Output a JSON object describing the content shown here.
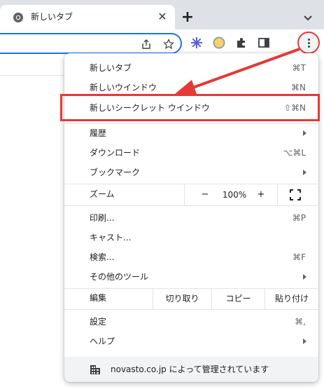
{
  "tab": {
    "title": "新しいタブ",
    "close": "✕"
  },
  "newtab": "+",
  "colors": {
    "annotation": "#e53935",
    "accent": "#1a73e8"
  },
  "menu": {
    "new_tab": {
      "label": "新しいタブ",
      "shortcut": "⌘T"
    },
    "new_window": {
      "label": "新しいウインドウ",
      "shortcut": "⌘N"
    },
    "incognito": {
      "label": "新しいシークレット ウインドウ",
      "shortcut": "⇧⌘N"
    },
    "history": {
      "label": "履歴"
    },
    "downloads": {
      "label": "ダウンロード",
      "shortcut": "⌥⌘L"
    },
    "bookmarks": {
      "label": "ブックマーク"
    },
    "zoom": {
      "label": "ズーム",
      "minus": "−",
      "value": "100%",
      "plus": "+"
    },
    "print": {
      "label": "印刷...",
      "shortcut": "⌘P"
    },
    "cast": {
      "label": "キャスト..."
    },
    "find": {
      "label": "検索...",
      "shortcut": "⌘F"
    },
    "more_tools": {
      "label": "その他のツール"
    },
    "edit": {
      "label": "編集",
      "cut": "切り取り",
      "copy": "コピー",
      "paste": "貼り付け"
    },
    "settings": {
      "label": "設定",
      "shortcut": "⌘,"
    },
    "help": {
      "label": "ヘルプ"
    },
    "managed": {
      "text": "novasto.co.jp によって管理されています"
    }
  }
}
